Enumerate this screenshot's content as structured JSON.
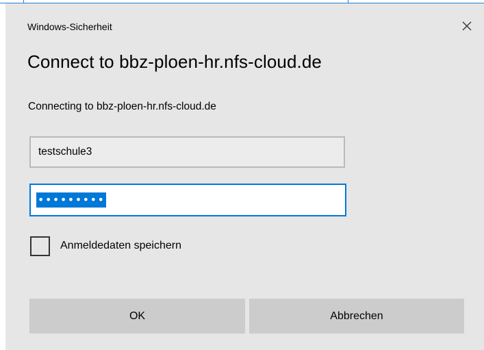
{
  "window": {
    "title": "Windows-Sicherheit",
    "close_icon": "close-icon"
  },
  "dialog": {
    "heading": "Connect to bbz-ploen-hr.nfs-cloud.de",
    "subtext": "Connecting to bbz-ploen-hr.nfs-cloud.de"
  },
  "fields": {
    "username_value": "testschule3",
    "password_value": "•••••••••"
  },
  "remember": {
    "label": "Anmeldedaten speichern",
    "checked": false
  },
  "buttons": {
    "ok_label": "OK",
    "cancel_label": "Abbrechen"
  },
  "colors": {
    "accent": "#0078d7",
    "dialog_background": "#e6e6e6",
    "button_background": "#cccccc"
  }
}
